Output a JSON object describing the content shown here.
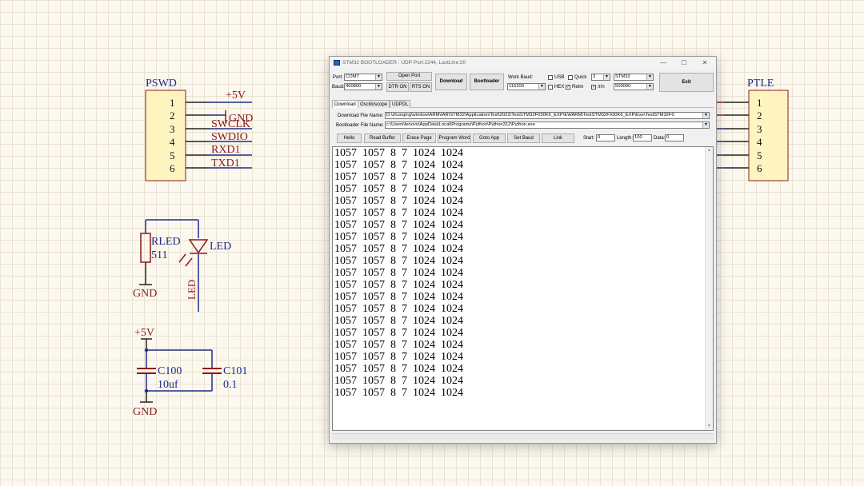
{
  "schematic": {
    "pswd": {
      "title": "PSWD",
      "pins": [
        "1",
        "2",
        "3",
        "4",
        "5",
        "6"
      ],
      "nets": [
        "+5V",
        "GND",
        "SWCLK",
        "SWDIO",
        "RXD1",
        "TXD1"
      ]
    },
    "ptle": {
      "title": "PTLE",
      "pins": [
        "1",
        "2",
        "3",
        "4",
        "5",
        "6"
      ]
    },
    "rled": {
      "ref": "RLED",
      "value": "511"
    },
    "led": {
      "ref": "LED",
      "net": "LED"
    },
    "gnd_label": "GND",
    "power_label": "+5V",
    "c100": {
      "ref": "C100",
      "value": "10uf"
    },
    "c101": {
      "ref": "C101",
      "value": "0.1"
    },
    "colors": {
      "wire": "#1e2a8c",
      "net_label": "#8b1a1a",
      "component": "#8b1a1a",
      "body": "#fdf4c0",
      "pin": "#222222"
    }
  },
  "window": {
    "title": "STM32 BOOTLOADER : UDP Port:2244, LastLine:20",
    "controls": {
      "minimize": "—",
      "maximize": "☐",
      "close": "✕"
    },
    "port_label": "Port:",
    "port_value": "COM7",
    "baud_label": "Baud:",
    "baud_value": "460800",
    "open_port": "Open Port",
    "dtr_on": "DTR ON",
    "rts_on": "RTS ON",
    "download": "Download",
    "bootloader": "Bootloader",
    "work_baud_label": "Work Baud:",
    "work_baud_value": "115200",
    "usb_label": "USB",
    "quick_label": "Quick",
    "quick_value": "3",
    "hex_label": "HEX",
    "retm_label": "Retm",
    "rn_label": "/r/n",
    "chip_value": "STM32",
    "rate_value": "500000",
    "exit": "Exit",
    "tabs": [
      "Download",
      "Oscilloscope",
      "UDPDL"
    ],
    "download_file_label": "Download File Name:",
    "download_file_value": "D:\\zhuoqing\\window\\ARM\\IAR\\STM32\\Application\\Test\\2023\\TestSTM32F030K6_EXP\\EWARM\\TestSTM32F030K6_EXP\\Exe\\TestSTM32F0",
    "bootloader_file_label": "Bootloader File Name:",
    "bootloader_file_value": "c:\\Users\\lenovo\\AppData\\Local\\Programs\\Python\\Python312\\Python.exe",
    "buttons": [
      "Hello",
      "Read Buffer",
      "Erase Page",
      "Program Word",
      "Goto App",
      "Set Baud",
      "Link"
    ],
    "start_label": "Start:",
    "start_value": "0",
    "length_label": "Length:",
    "length_value": "100",
    "data_label": "Data:",
    "data_value": "0",
    "output_lines": [
      "1057  1057  8  7  1024  1024",
      "1057  1057  8  7  1024  1024",
      "1057  1057  8  7  1024  1024",
      "1057  1057  8  7  1024  1024",
      "1057  1057  8  7  1024  1024",
      "1057  1057  8  7  1024  1024",
      "1057  1057  8  7  1024  1024",
      "1057  1057  8  7  1024  1024",
      "1057  1057  8  7  1024  1024",
      "1057  1057  8  7  1024  1024",
      "1057  1057  8  7  1024  1024",
      "1057  1057  8  7  1024  1024",
      "1057  1057  8  7  1024  1024",
      "1057  1057  8  7  1024  1024",
      "1057  1057  8  7  1024  1024",
      "1057  1057  8  7  1024  1024",
      "1057  1057  8  7  1024  1024",
      "1057  1057  8  7  1024  1024",
      "1057  1057  8  7  1024  1024",
      "1057  1057  8  7  1024  1024",
      "1057  1057  8  7  1024  1024"
    ]
  }
}
